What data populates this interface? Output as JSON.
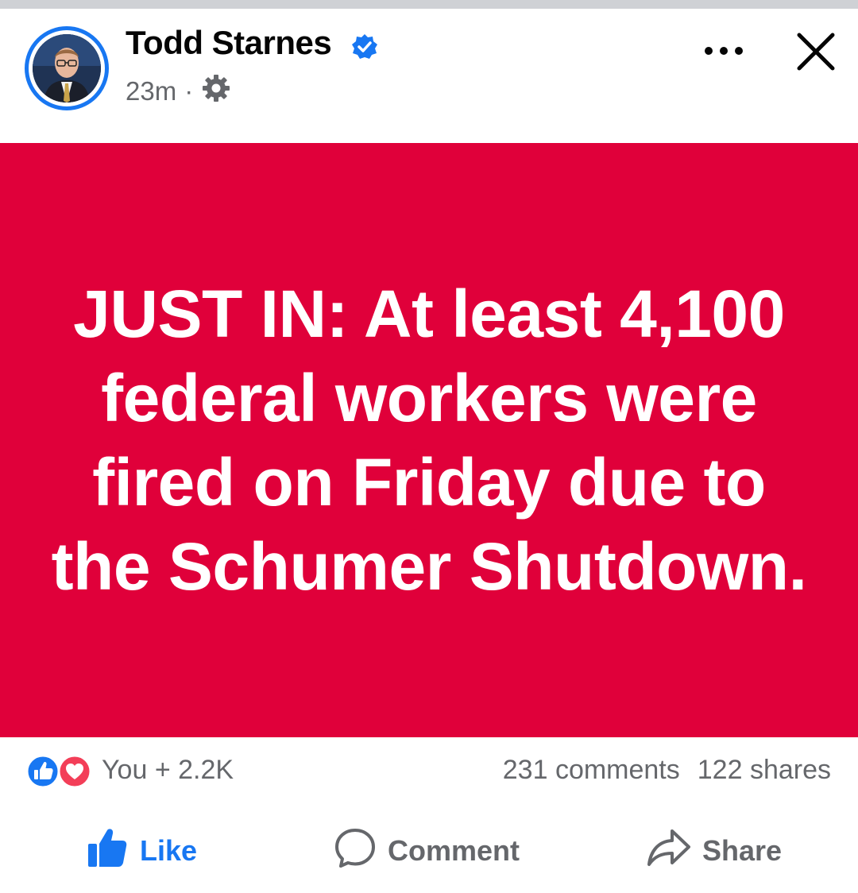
{
  "post": {
    "author": "Todd Starnes",
    "time": "23m",
    "separator": "·",
    "headline": "JUST IN: At least 4,100 federal workers were fired on Friday due to the Schumer Shutdown."
  },
  "stats": {
    "reactions_text": "You + 2.2K",
    "comments": "231 comments",
    "shares": "122 shares"
  },
  "actions": {
    "like": "Like",
    "comment": "Comment",
    "share": "Share"
  },
  "colors": {
    "banner": "#e0003a",
    "brand": "#1877f2",
    "text_secondary": "#65676b"
  },
  "icons": [
    "verified-badge-icon",
    "settings-gear-icon",
    "more-options-icon",
    "close-icon",
    "like-reaction-icon",
    "love-reaction-icon",
    "thumbs-up-icon",
    "comment-icon",
    "share-icon"
  ]
}
